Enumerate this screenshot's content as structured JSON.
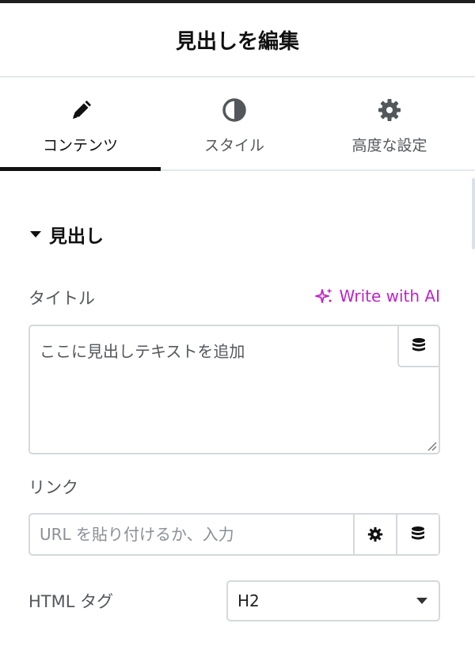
{
  "header": {
    "title": "見出しを編集"
  },
  "tabs": [
    {
      "label": "コンテンツ",
      "icon": "pencil-icon",
      "active": true
    },
    {
      "label": "スタイル",
      "icon": "contrast-icon",
      "active": false
    },
    {
      "label": "高度な設定",
      "icon": "gear-icon",
      "active": false
    }
  ],
  "section": {
    "title": "見出し"
  },
  "title_field": {
    "label": "タイトル",
    "ai_link": "Write with AI",
    "value": "ここに見出しテキストを追加"
  },
  "link_field": {
    "label": "リンク",
    "placeholder": "URL を貼り付けるか、入力"
  },
  "html_tag_field": {
    "label": "HTML タグ",
    "selected": "H2"
  },
  "colors": {
    "accent": "#c023c9",
    "text": "#1f2124",
    "border": "#d5d8dc"
  }
}
